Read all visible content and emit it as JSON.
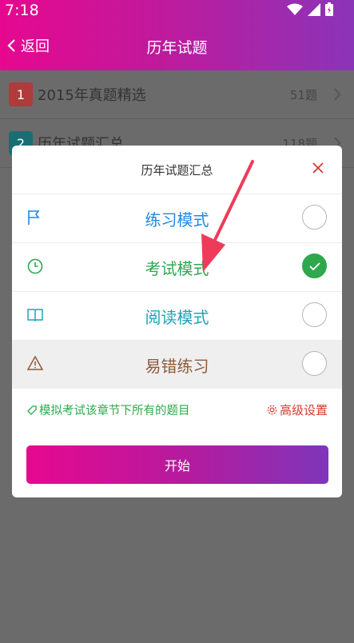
{
  "status": {
    "time": "7:18"
  },
  "nav": {
    "back_label": "返回",
    "title": "历年试题"
  },
  "list": [
    {
      "num": "1",
      "title": "2015年真题精选",
      "count": "51题",
      "color": "#b03b3b"
    },
    {
      "num": "2",
      "title": "历年试题汇总",
      "count": "118题",
      "color": "#1a6e73"
    }
  ],
  "dialog": {
    "title": "历年试题汇总",
    "modes": [
      {
        "label": "练习模式",
        "icon": "flag-icon",
        "color": "#1e88e5",
        "selected": false
      },
      {
        "label": "考试模式",
        "icon": "clock-icon",
        "color": "#2ea84d",
        "selected": true
      },
      {
        "label": "阅读模式",
        "icon": "book-icon",
        "color": "#1fa3b8",
        "selected": false
      },
      {
        "label": "易错练习",
        "icon": "warning-icon",
        "color": "#8d5a3a",
        "selected": false
      }
    ],
    "description": "模拟考试该章节下所有的题目",
    "advanced_label": "高级设置",
    "start_label": "开始"
  },
  "colors": {
    "accent_pink": "#e6088f",
    "accent_purple": "#7e36ba",
    "success": "#2ea84d",
    "danger": "#d33b2f"
  }
}
